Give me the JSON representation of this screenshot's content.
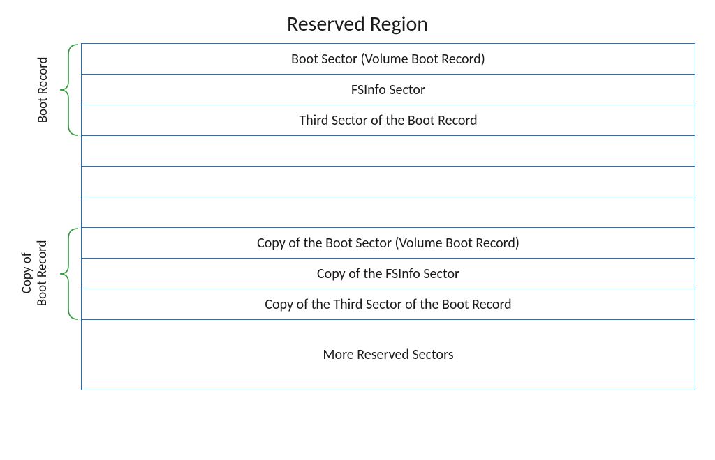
{
  "title": "Reserved Region",
  "rows": [
    {
      "label": "Boot Sector (Volume Boot Record)"
    },
    {
      "label": "FSInfo Sector"
    },
    {
      "label": "Third Sector of the Boot Record"
    },
    {
      "label": ""
    },
    {
      "label": ""
    },
    {
      "label": ""
    },
    {
      "label": "Copy of the Boot Sector (Volume Boot Record)"
    },
    {
      "label": "Copy of the FSInfo Sector"
    },
    {
      "label": "Copy of the Third Sector of the Boot Record"
    },
    {
      "label": "More Reserved Sectors"
    }
  ],
  "side_labels": {
    "top": "Boot Record",
    "bottom_line1": "Copy of",
    "bottom_line2": "Boot Record"
  },
  "colors": {
    "border": "#1f6fc2",
    "brace": "#2e9a3a"
  }
}
